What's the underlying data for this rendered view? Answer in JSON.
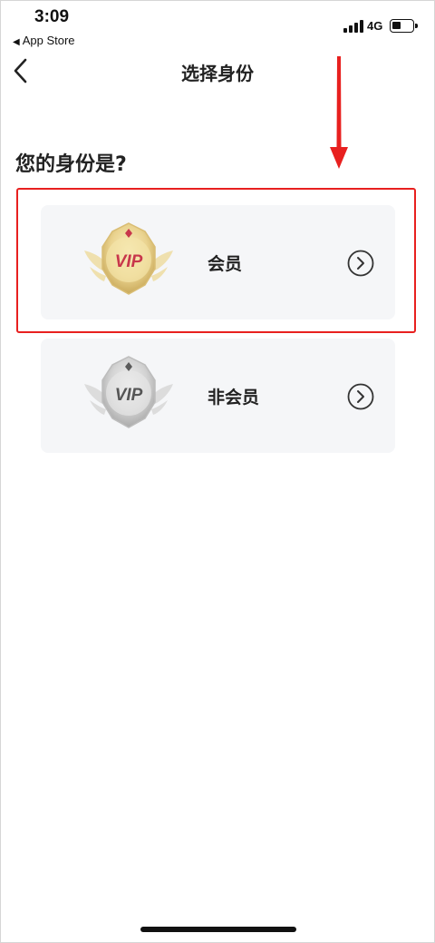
{
  "status_bar": {
    "time": "3:09",
    "back_app": "App Store",
    "network": "4G"
  },
  "nav": {
    "title": "选择身份",
    "back_icon": "chevron-left-icon"
  },
  "question": "您的身份是?",
  "options": [
    {
      "label": "会员",
      "badge_text": "VIP",
      "badge_color": "#e8cf86",
      "badge_text_color": "#c8364b",
      "icon": "vip-gold-badge-icon",
      "arrow_icon": "chevron-right-circle-icon"
    },
    {
      "label": "非会员",
      "badge_text": "VIP",
      "badge_color": "#d3d3d3",
      "badge_text_color": "#555555",
      "icon": "vip-silver-badge-icon",
      "arrow_icon": "chevron-right-circle-icon"
    }
  ],
  "annotation": {
    "highlight_color": "#e8201f"
  },
  "colors": {
    "card_bg": "#f5f6f8",
    "text": "#222222"
  }
}
